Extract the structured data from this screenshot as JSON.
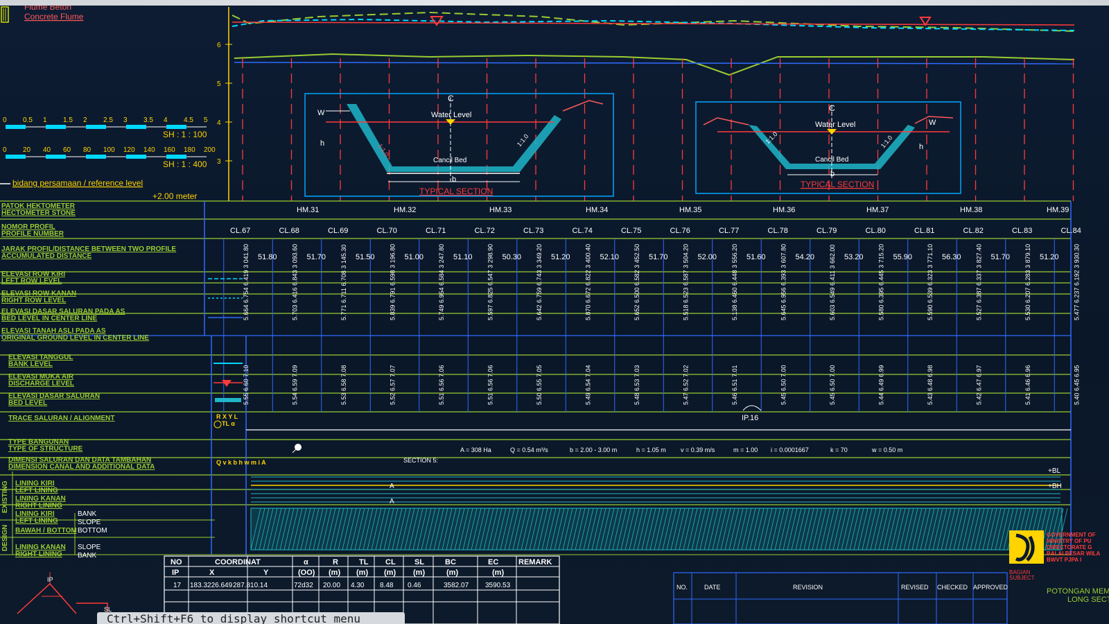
{
  "legend": {
    "flume_top": "Flume Beton",
    "flume_bottom": "Concrete Flume",
    "scale1_ticks": [
      "0",
      "0.5",
      "1",
      "1.5",
      "2",
      "2.5",
      "3",
      "3.5",
      "4",
      "4.5",
      "5"
    ],
    "scale1_label": "SH : 1 : 100",
    "scale2_ticks": [
      "0",
      "20",
      "40",
      "60",
      "80",
      "100",
      "120",
      "140",
      "160",
      "180",
      "200"
    ],
    "scale2_label": "SH : 1 : 400",
    "reference_label": "bidang persamaan / reference level",
    "reference_value": "+2.00 meter"
  },
  "profile": {
    "axis_ticks": [
      "6",
      "5",
      "4",
      "3"
    ],
    "section1": {
      "cl": "C",
      "water": "Water Level",
      "bed": "Cancil Bed",
      "slope_left": "1:1.0",
      "slope_right": "1:1.0",
      "w": "W",
      "h": "h",
      "b": "b",
      "title": "TYPICAL SECTION"
    },
    "section2": {
      "cl": "C",
      "water": "Water Level",
      "bed": "Cancil Bed",
      "slope_left": "1:1.0",
      "slope_right": "1:1.0",
      "w": "W",
      "h": "h",
      "b": "b",
      "title": "TYPICAL SECTION"
    }
  },
  "table": {
    "rows": [
      {
        "id": "patok",
        "l1": "PATOK HEKTOMETER",
        "l2": "HECTOMETER STONE"
      },
      {
        "id": "nomor",
        "l1": "NOMOR PROFIL",
        "l2": "PROFILE NUMBER"
      },
      {
        "id": "jarak",
        "l1": "JARAK PROFIL/DISTANCE BETWEEN TWO PROFILE",
        "l2": "ACCUMULATED DISTANCE"
      },
      {
        "id": "rowkiri",
        "l1": "ELEVASI ROW KIRI",
        "l2": "LEFT ROW LEVEL"
      },
      {
        "id": "rowkanan",
        "l1": "ELEVASI ROW KANAN",
        "l2": "RIGHT ROW LEVEL"
      },
      {
        "id": "dasar_as",
        "l1": "ELEVASI DASAR SALURAN PADA AS",
        "l2": "BED LEVEL IN CENTER LINE"
      },
      {
        "id": "tanah",
        "l1": "ELEVASI TANAH ASLI PADA AS",
        "l2": "ORIGINAL GROUND LEVEL IN CENTER LINE"
      },
      {
        "id": "tanggul",
        "l1": "ELEVASI TANGGUL",
        "l2": "BANK LEVEL"
      },
      {
        "id": "muka",
        "l1": "ELEVASI MUKA AIR",
        "l2": "DISCHARGE LEVEL"
      },
      {
        "id": "dasar",
        "l1": "ELEVASI DASAR SALURAN",
        "l2": "BED LEVEL"
      },
      {
        "id": "trace",
        "l1": "TRACE SALURAN / ALIGNMENT",
        "l2": ""
      },
      {
        "id": "tipe",
        "l1": "TYPE BANGUNAN",
        "l2": "TYPE OF STRUCTURE"
      },
      {
        "id": "dimensi",
        "l1": "DIMENSI SALURAN DAN DATA TAMBAHAN",
        "l2": "DIMENSION CANAL AND ADDITIONAL DATA"
      },
      {
        "id": "lkiri",
        "l1": "LINING KIRI",
        "l2": "LEFT LINING"
      },
      {
        "id": "lkanan",
        "l1": "LINING KANAN",
        "l2": "RIGHT LINING"
      }
    ],
    "design_rows": [
      {
        "l1": "LINING KIRI",
        "l2": "LEFT LINING",
        "r1": "BANK",
        "r2": "SLOPE"
      },
      {
        "l1": "BAWAH / BOTTOM",
        "l2": "",
        "r1": "BOTTOM",
        "r2": ""
      },
      {
        "l1": "LINING KANAN",
        "l2": "RIGHT LINING",
        "r1": "SLOPE",
        "r2": "BANK"
      }
    ],
    "side_existing": "EXISTING",
    "side_design": "DESIGN",
    "trace_symbol": "R X Y L",
    "trace_symbol2": "TL α",
    "dim_symbol": "Q v k b h w m i A",
    "hm": [
      "HM.31",
      "HM.32",
      "HM.33",
      "HM.34",
      "HM.35",
      "HM.36",
      "HM.37",
      "HM.38",
      "HM.39"
    ],
    "cl": [
      "CL.67",
      "CL.68",
      "CL.69",
      "CL.70",
      "CL.71",
      "CL.72",
      "CL.73",
      "CL.74",
      "CL.75",
      "CL.76",
      "CL.77",
      "CL.78",
      "CL.79",
      "CL.80",
      "CL.81",
      "CL.82",
      "CL.83",
      "CL.84"
    ],
    "distances": [
      "51.80",
      "51.70",
      "51.50",
      "51.00",
      "51.10",
      "50.30",
      "51.20",
      "52.10",
      "51.70",
      "52.00",
      "51.60",
      "54.20",
      "53.20",
      "55.90",
      "56.30",
      "51.70",
      "51.20"
    ],
    "accum": [
      "3 041.80",
      "3 093.60",
      "3 145.30",
      "3 196.80",
      "3 247.80",
      "3 298.90",
      "3 349.20",
      "3 400.40",
      "3 452.50",
      "3 504.20",
      "3 556.20",
      "3 607.80",
      "3 662.00",
      "3 715.20",
      "3 771.10",
      "3 827.40",
      "3 879.10",
      "3 930.30"
    ],
    "elev_row": [
      "5.664 6.754 6.419",
      "5.703 6.416 6.843",
      "5.771 6.711 6.708",
      "5.839 6.791 6.598",
      "5.749 6.954 6.584",
      "5.597 6.825 6.547",
      "5.642 6.759 6.743",
      "5.870 6.672 6.822",
      "5.652 6.500 6.582",
      "5.518 6.523 6.587",
      "5.138 6.460 6.448",
      "5.645 6.956 6.393",
      "5.603 6.549 6.411",
      "5.580 6.395 6.445",
      "5.590 6.539 6.323",
      "5.527 6.387 6.337",
      "5.530 6.207 6.283",
      "5.477 6.237 6.192"
    ],
    "bank": [
      "7.10",
      "7.09",
      "7.08",
      "7.07",
      "7.06",
      "7.06",
      "7.05",
      "7.04",
      "7.03",
      "7.02",
      "7.01",
      "7.00",
      "7.00",
      "6.99",
      "6.98",
      "6.97",
      "6.96",
      "6.95"
    ],
    "water": [
      "6.60",
      "6.59",
      "6.58",
      "6.57",
      "6.56",
      "6.56",
      "6.55",
      "6.54",
      "6.53",
      "6.52",
      "6.51",
      "6.50",
      "6.50",
      "6.49",
      "6.48",
      "6.47",
      "6.46",
      "6.45"
    ],
    "bed": [
      "5.55",
      "5.54",
      "5.53",
      "5.52",
      "5.51",
      "5.51",
      "5.50",
      "5.49",
      "5.48",
      "5.47",
      "5.46",
      "5.45",
      "5.45",
      "5.44",
      "5.43",
      "5.42",
      "5.41",
      "5.40"
    ],
    "ip_label": "IP.16",
    "section_data": [
      "SECTION 5:",
      "A = 308 Ha",
      "Q = 0.54 m³/s",
      "b = 2.00 - 3.00 m",
      "h = 1.05 m",
      "v = 0.39 m/s",
      "m = 1.00",
      "i = 0.0001667",
      "k = 70",
      "w = 0.50 m"
    ],
    "lining_marker_a": "A",
    "lining_marker_b": "A",
    "lining_end1": "+BL",
    "lining_end2": "+BH"
  },
  "coord_table": {
    "headers1": [
      "NO",
      "COORDINAT",
      "α",
      "R",
      "TL",
      "CL",
      "SL",
      "BC",
      "EC",
      "REMARK"
    ],
    "headers2": [
      "IP",
      "X",
      "Y",
      "(OO)",
      "(m)",
      "(m)",
      "(m)",
      "(m)",
      "(m)",
      "(m)"
    ],
    "row": [
      "17",
      "183.3226.649",
      "287.810.14",
      "72d32",
      "20.00",
      "4.30",
      "8.48",
      "0.46",
      "3582.07",
      "3590.53",
      ""
    ]
  },
  "sketch": {
    "ip": "IP",
    "sl": "SL"
  },
  "revision_table": {
    "headers": [
      "NO.",
      "DATE",
      "REVISION",
      "REVISED",
      "CHECKED",
      "APPROVED"
    ]
  },
  "title_block": {
    "gov": [
      "GOVERNMENT OF",
      "MINISTRY OF PU",
      "DIRECTORATE G",
      "BALAI BESAR WILA",
      "BWVT PJPA I"
    ],
    "bagian": "BAGIAN",
    "subject": "SUBJECT",
    "title1": "POTONGAN MEM",
    "title2": "LONG SECTI"
  },
  "shortcut": "Ctrl+Shift+F6 to display shortcut menu"
}
